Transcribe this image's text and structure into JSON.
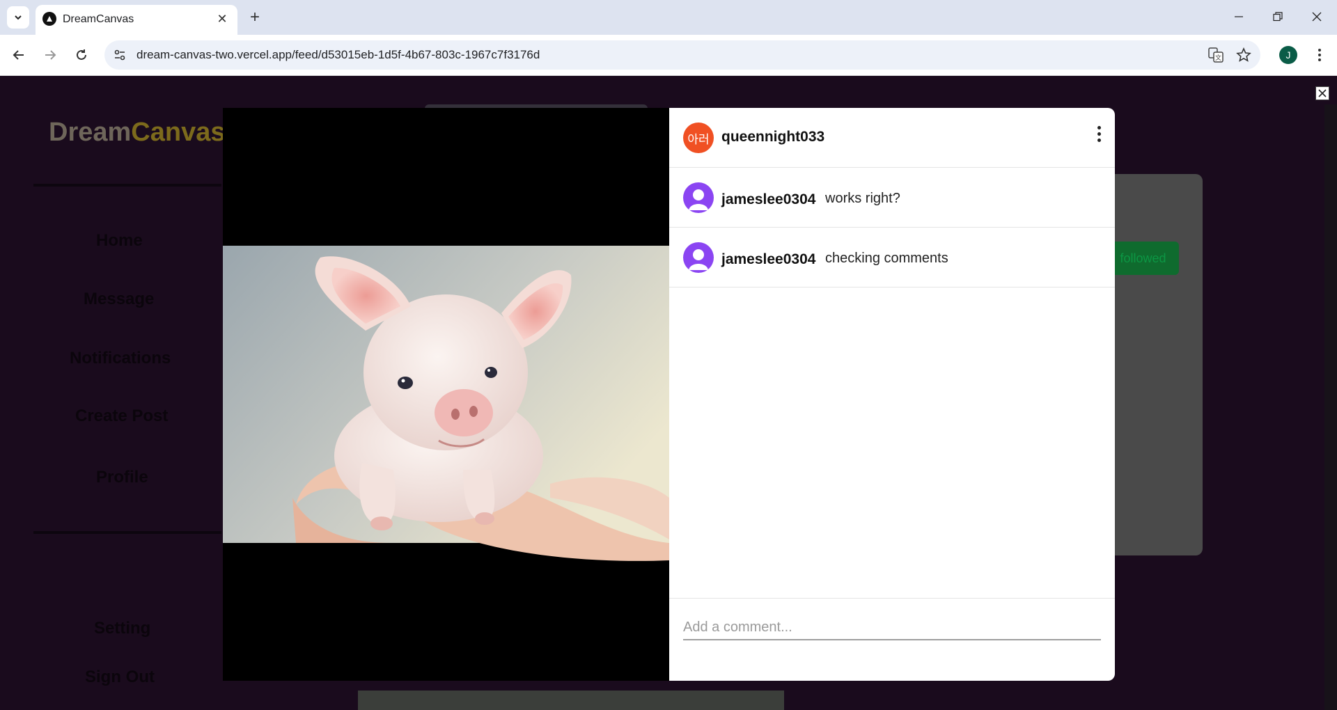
{
  "browser": {
    "tab_title": "DreamCanvas",
    "url": "dream-canvas-two.vercel.app/feed/d53015eb-1d5f-4b67-803c-1967c7f3176d",
    "profile_initial": "J"
  },
  "page": {
    "logo_part1": "Dream",
    "logo_part2": "Canvas",
    "nav": [
      "Home",
      "Message",
      "Notifications",
      "Create Post",
      "Profile",
      "Setting",
      "Sign Out"
    ],
    "follow_label": "followed"
  },
  "post": {
    "author_avatar_text": "아러",
    "author": "queennight033",
    "image_alt": "piglet in hand",
    "comments": [
      {
        "user": "jameslee0304",
        "text": "works right?"
      },
      {
        "user": "jameslee0304",
        "text": "checking comments"
      }
    ],
    "comment_placeholder": "Add a comment..."
  },
  "colors": {
    "author_avatar": "#f05023",
    "user_avatar": "#8b45f2",
    "overlay_background": "#1a0b1d"
  }
}
